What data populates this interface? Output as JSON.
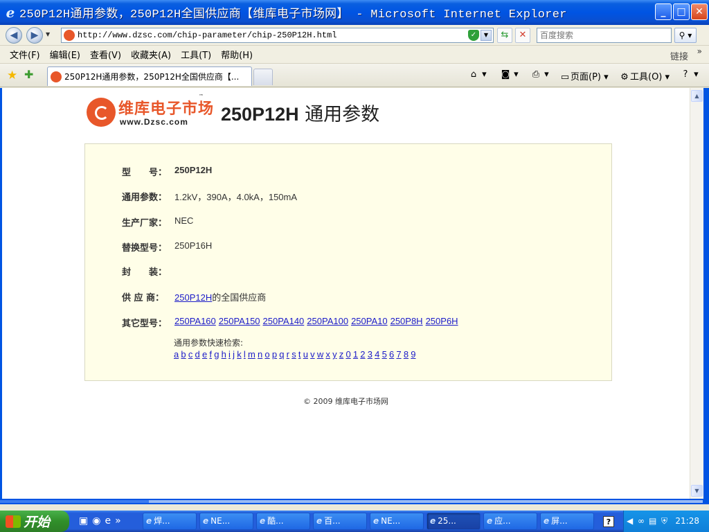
{
  "window": {
    "title": "250P12H通用参数，250P12H全国供应商【维库电子市场网】 - Microsoft Internet Explorer",
    "minimize": "_",
    "maximize": "□",
    "close": "✕"
  },
  "address": {
    "url": "http://www.dzsc.com/chip-parameter/chip-250P12H.html",
    "search_placeholder": "百度搜索"
  },
  "menu": {
    "items": [
      "文件(F)",
      "编辑(E)",
      "查看(V)",
      "收藏夹(A)",
      "工具(T)",
      "帮助(H)"
    ],
    "links_label": "链接"
  },
  "tabs": {
    "active_title": "250P12H通用参数，250P12H全国供应商【...",
    "page_label": "页面(P)",
    "tools_label": "工具(O)"
  },
  "logo": {
    "brand": "维库电子市场",
    "tm": "™",
    "site": "www.Dzsc.com"
  },
  "page": {
    "title_part": "250P12H",
    "title_rest": " 通用参数"
  },
  "params": {
    "model_label": "型　　号：",
    "model_value": "250P12H",
    "general_label": "通用参数：",
    "general_value": "1.2kV，390A，4.0kA，150mA",
    "maker_label": "生产厂家：",
    "maker_value": "NEC",
    "replace_label": "替换型号：",
    "replace_value": "250P16H",
    "package_label": "封　　装：",
    "package_value": "",
    "supplier_label": "供 应 商：",
    "supplier_link": "250P12H",
    "supplier_suffix": "的全国供应商",
    "others_label": "其它型号：",
    "others": [
      "250PA160",
      "250PA150",
      "250PA140",
      "250PA100",
      "250PA10",
      "250P8H",
      "250P6H"
    ],
    "quick_search_label": "通用参数快速检索:",
    "letters": [
      "a",
      "b",
      "c",
      "d",
      "e",
      "f",
      "g",
      "h",
      "i",
      "j",
      "k",
      "l",
      "m",
      "n",
      "o",
      "p",
      "q",
      "r",
      "s",
      "t",
      "u",
      "v",
      "w",
      "x",
      "y",
      "z",
      "0",
      "1",
      "2",
      "3",
      "4",
      "5",
      "6",
      "7",
      "8",
      "9"
    ]
  },
  "footer": {
    "copyright": "© 2009 维库电子市场网"
  },
  "taskbar": {
    "start_label": "开始",
    "buttons": [
      "焊...",
      "NE...",
      "酷...",
      "百...",
      "NE...",
      "25...",
      "应...",
      "屏..."
    ],
    "active_index": 5,
    "clock": "21:28"
  },
  "colors": {
    "xp_blue": "#0054e3",
    "brand_orange": "#e8572a",
    "panel_bg": "#fffee8",
    "link": "#1a1ac8"
  }
}
